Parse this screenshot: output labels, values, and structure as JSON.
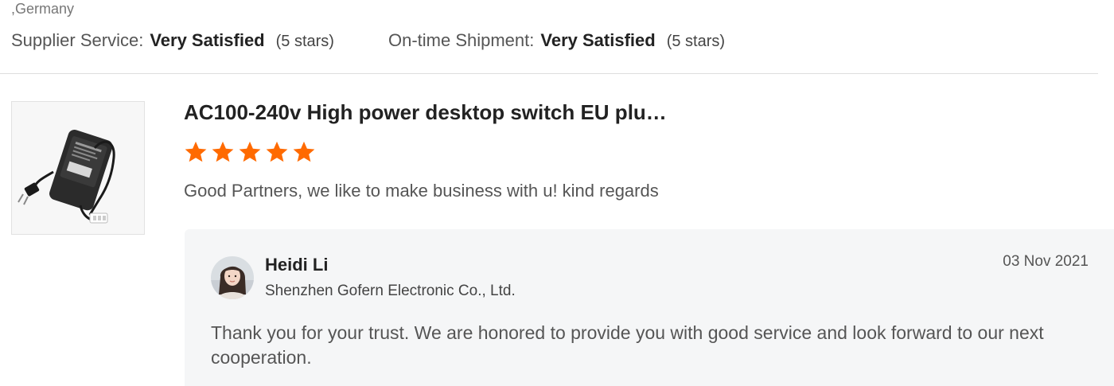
{
  "reviewer": {
    "location": ",Germany"
  },
  "ratings": {
    "supplier_service": {
      "label": "Supplier Service:",
      "value": "Very Satisfied",
      "stars_text": "(5 stars)"
    },
    "on_time_shipment": {
      "label": "On-time Shipment:",
      "value": "Very Satisfied",
      "stars_text": "(5 stars)"
    }
  },
  "product": {
    "title": "AC100-240v High power desktop switch EU plu…",
    "rating": 5,
    "star_color": "#ff6a00",
    "thumbnail_icon": "power-adapter-image"
  },
  "review": {
    "text": "Good Partners, we like to make business with u! kind regards"
  },
  "reply": {
    "name": "Heidi Li",
    "company": "Shenzhen Gofern Electronic Co., Ltd.",
    "date": "03 Nov 2021",
    "text": "Thank you for your trust. We are honored to provide you with good service and look forward to our next cooperation."
  },
  "colors": {
    "accent": "#ff6a00",
    "reply_background": "#f5f6f7",
    "divider": "#dddddd"
  }
}
